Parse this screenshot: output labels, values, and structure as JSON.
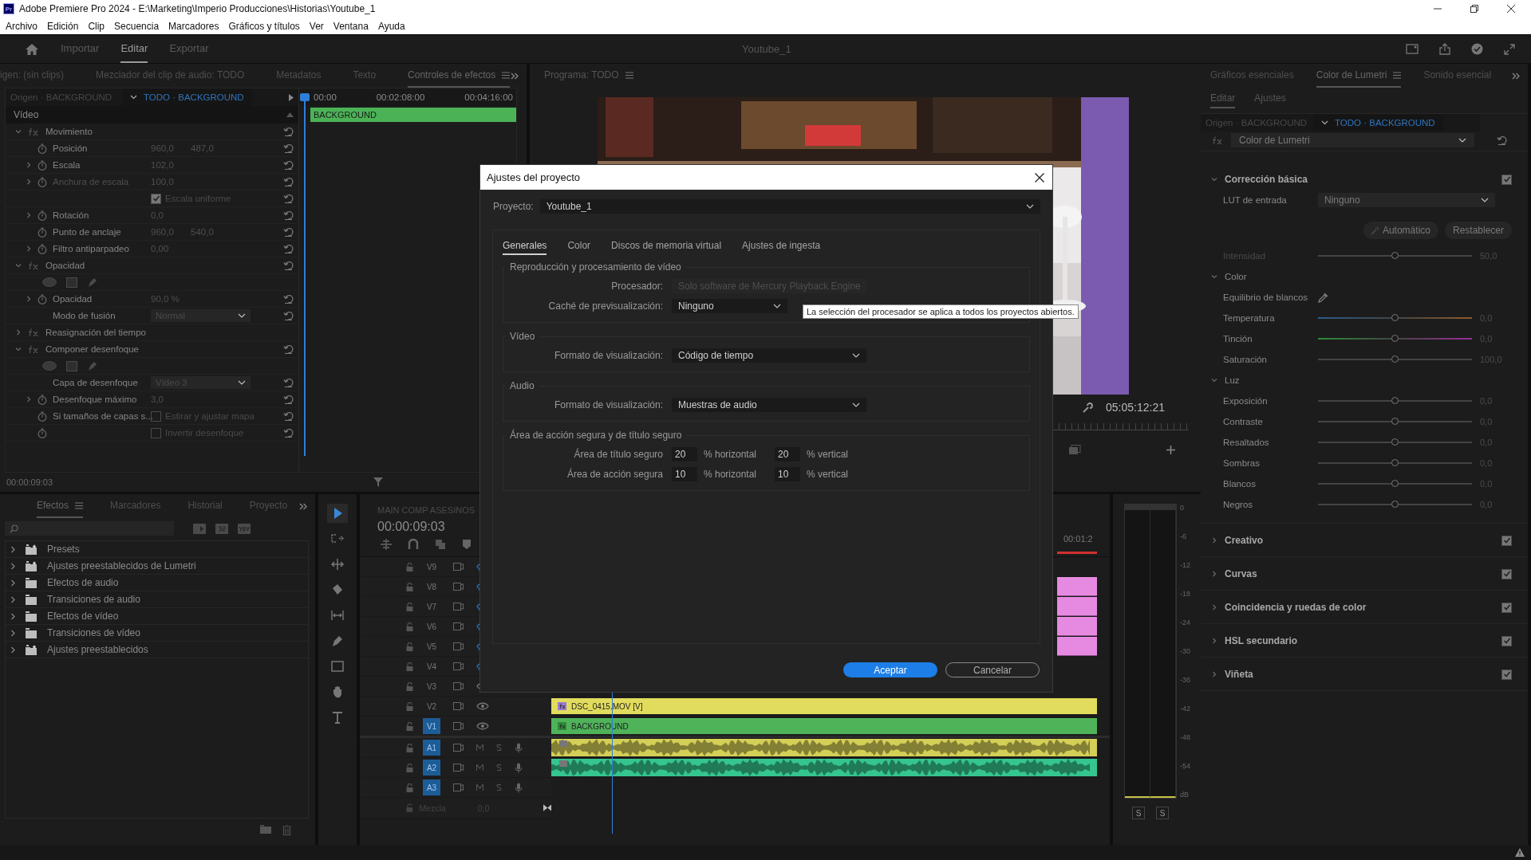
{
  "window": {
    "badge": "Pr",
    "title": "Adobe Premiere Pro 2024 - E:\\Marketing\\Imperio Producciones\\Historias\\Youtube_1"
  },
  "menu": [
    "Archivo",
    "Edición",
    "Clip",
    "Secuencia",
    "Marcadores",
    "Gráficos y títulos",
    "Ver",
    "Ventana",
    "Ayuda"
  ],
  "workspace_tabs": [
    {
      "label": "Importar",
      "selected": false
    },
    {
      "label": "Editar",
      "selected": true
    },
    {
      "label": "Exportar",
      "selected": false
    }
  ],
  "project_name": "Youtube_1",
  "effect_controls": {
    "tabs": [
      {
        "label": "igen: (sin clips)",
        "selected": false
      },
      {
        "label": "Mezclador del clip de audio: TODO",
        "selected": false
      },
      {
        "label": "Metadatos",
        "selected": false
      },
      {
        "label": "Texto",
        "selected": false
      },
      {
        "label": "Controles de efectos",
        "selected": true
      }
    ],
    "source": "Origen · BACKGROUND",
    "sequence": "TODO · BACKGROUND",
    "ruler": [
      "00:00",
      "00:02:08:00",
      "00:04:16:00"
    ],
    "clip": "BACKGROUND",
    "section": "Vídeo",
    "rows": [
      {
        "kind": "effect",
        "label": "Movimiento",
        "expanded": true,
        "resettable": true
      },
      {
        "kind": "param",
        "label": "Posición",
        "values": [
          "960,0",
          "487,0"
        ],
        "expandable": false,
        "disabled": false
      },
      {
        "kind": "param",
        "label": "Escala",
        "values": [
          "102,0"
        ],
        "expandable": true,
        "disabled": false
      },
      {
        "kind": "param",
        "label": "Anchura de escala",
        "values": [
          "100,0"
        ],
        "expandable": true,
        "disabled": true
      },
      {
        "kind": "checkbox",
        "text": "Escala uniforme",
        "checked": true,
        "keyframeable": false
      },
      {
        "kind": "param",
        "label": "Rotación",
        "values": [
          "0,0"
        ],
        "expandable": true,
        "disabled": false
      },
      {
        "kind": "param",
        "label": "Punto de anclaje",
        "values": [
          "960,0",
          "540,0"
        ],
        "expandable": false,
        "disabled": false
      },
      {
        "kind": "param",
        "label": "Filtro antiparpadeo",
        "values": [
          "0,00"
        ],
        "expandable": true,
        "disabled": false
      },
      {
        "kind": "effect",
        "label": "Opacidad",
        "expanded": true,
        "resettable": true
      },
      {
        "kind": "masks"
      },
      {
        "kind": "param",
        "label": "Opacidad",
        "values": [
          "90,0 %"
        ],
        "expandable": true,
        "disabled": false
      },
      {
        "kind": "dropdown",
        "label": "Modo de fusión",
        "value": "Normal"
      },
      {
        "kind": "effect",
        "label": "Reasignación del tiempo",
        "expanded": false,
        "resettable": false
      },
      {
        "kind": "effect",
        "label": "Componer desenfoque",
        "expanded": true,
        "resettable": true
      },
      {
        "kind": "masks"
      },
      {
        "kind": "dropdown",
        "label": "Capa de desenfoque",
        "value": "Vídeo 3"
      },
      {
        "kind": "param",
        "label": "Desenfoque máximo",
        "values": [
          "3,0"
        ],
        "expandable": true,
        "disabled": false
      },
      {
        "kind": "checkbox",
        "label": "Si tamaños de capas s...",
        "text": "Estirar y ajustar mapa",
        "checked": false,
        "keyframeable": true
      },
      {
        "kind": "checkbox",
        "text": "Invertir desenfoque",
        "checked": false,
        "keyframeable": true
      }
    ],
    "timecode": "00:00:09:03"
  },
  "program": {
    "tab": "Programa: TODO",
    "timecode": "05:05:12:21"
  },
  "lumetri": {
    "tabs": [
      {
        "label": "Gráficos esenciales",
        "selected": false
      },
      {
        "label": "Color de Lumetri",
        "selected": true
      },
      {
        "label": "Sonido esencial",
        "selected": false
      }
    ],
    "subtabs": [
      {
        "label": "Editar",
        "selected": true
      },
      {
        "label": "Ajustes",
        "selected": false
      }
    ],
    "source": "Origen · BACKGROUND",
    "sequence": "TODO · BACKGROUND",
    "effect": "Color de Lumetri",
    "basic": {
      "title": "Corrección básica",
      "enabled": true,
      "expanded": true,
      "lut_label": "LUT de entrada",
      "lut_value": "Ninguno",
      "buttons": [
        "Automático",
        "Restablecer"
      ],
      "intensity": {
        "label": "Intensidad",
        "level": 0.5,
        "reading": "50,0",
        "disabled": true
      },
      "groups": [
        {
          "title": "Color",
          "expanded": true,
          "white_balance": "Equilibrio de blancos",
          "sliders": [
            {
              "label": "Temperatura",
              "kind": "temperature",
              "level": 0.5,
              "reading": "0,0"
            },
            {
              "label": "Tinción",
              "kind": "tint",
              "level": 0.5,
              "reading": "0,0"
            },
            {
              "label": "Saturación",
              "kind": "plain",
              "level": 0.5,
              "reading": "100,0"
            }
          ]
        },
        {
          "title": "Luz",
          "expanded": true,
          "sliders": [
            {
              "label": "Exposición",
              "kind": "plain",
              "level": 0.5,
              "reading": "0,0"
            },
            {
              "label": "Contraste",
              "kind": "plain",
              "level": 0.5,
              "reading": "0,0"
            },
            {
              "label": "Resaltados",
              "kind": "plain",
              "level": 0.5,
              "reading": "0,0"
            },
            {
              "label": "Sombras",
              "kind": "plain",
              "level": 0.5,
              "reading": "0,0"
            },
            {
              "label": "Blancos",
              "kind": "plain",
              "level": 0.5,
              "reading": "0,0"
            },
            {
              "label": "Negros",
              "kind": "plain",
              "level": 0.5,
              "reading": "0,0"
            }
          ]
        }
      ]
    },
    "sections": [
      {
        "title": "Creativo",
        "expanded": false,
        "enabled": true
      },
      {
        "title": "Curvas",
        "expanded": false,
        "enabled": true
      },
      {
        "title": "Coincidencia y ruedas de color",
        "expanded": false,
        "enabled": true
      },
      {
        "title": "HSL secundario",
        "expanded": false,
        "enabled": true
      },
      {
        "title": "Viñeta",
        "expanded": false,
        "enabled": true
      }
    ]
  },
  "effects_panel": {
    "tabs": [
      {
        "label": "Efectos",
        "selected": true
      },
      {
        "label": "Marcadores",
        "selected": false
      },
      {
        "label": "Historial",
        "selected": false
      },
      {
        "label": "Proyecto",
        "selected": false
      }
    ],
    "items": [
      {
        "label": "Presets",
        "kind": "preset"
      },
      {
        "label": "Ajustes preestablecidos de Lumetri",
        "kind": "preset"
      },
      {
        "label": "Efectos de audio",
        "kind": "folder"
      },
      {
        "label": "Transiciones de audio",
        "kind": "folder"
      },
      {
        "label": "Efectos de vídeo",
        "kind": "folder"
      },
      {
        "label": "Transiciones de vídeo",
        "kind": "folder"
      },
      {
        "label": "Ajustes preestablecidos",
        "kind": "preset"
      }
    ]
  },
  "tools": [
    {
      "kind": "select",
      "selected": true
    },
    {
      "kind": "track",
      "selected": false
    },
    {
      "kind": "ripple",
      "selected": false
    },
    {
      "kind": "razor",
      "selected": false
    },
    {
      "kind": "slip",
      "selected": false
    },
    {
      "kind": "pen",
      "selected": false
    },
    {
      "kind": "rectangle",
      "selected": false
    },
    {
      "kind": "hand",
      "selected": false
    },
    {
      "kind": "type",
      "selected": false
    }
  ],
  "timeline": {
    "tab": "MAIN COMP ASESINOS",
    "timecode": "00:00:09:03",
    "ruler": "00:01:2",
    "tracks": [
      {
        "name": "V9",
        "kind": "video",
        "targeted": false,
        "visible": false
      },
      {
        "name": "V8",
        "kind": "video",
        "targeted": false,
        "visible": false,
        "clip": {
          "kind": "edge",
          "color": "#e58ae0"
        }
      },
      {
        "name": "V7",
        "kind": "video",
        "targeted": false,
        "visible": false,
        "clip": {
          "kind": "edge",
          "color": "#e58ae0"
        }
      },
      {
        "name": "V6",
        "kind": "video",
        "targeted": false,
        "visible": false,
        "clip": {
          "kind": "edge",
          "color": "#e58ae0"
        }
      },
      {
        "name": "V5",
        "kind": "video",
        "targeted": false,
        "visible": false,
        "clip": {
          "kind": "edge",
          "color": "#e58ae0"
        }
      },
      {
        "name": "V4",
        "kind": "video",
        "targeted": false,
        "visible": false
      },
      {
        "name": "V3",
        "kind": "video",
        "targeted": false,
        "visible": true
      },
      {
        "name": "V2",
        "kind": "video",
        "targeted": false,
        "visible": true,
        "clip": {
          "kind": "video",
          "label": "DSC_0415.MOV [V]",
          "color": "#e2dc5e"
        }
      },
      {
        "name": "V1",
        "kind": "video",
        "targeted": true,
        "visible": true,
        "clip": {
          "kind": "video",
          "label": "BACKGROUND",
          "color": "#4fb35a"
        }
      },
      {
        "name": "A1",
        "kind": "audio",
        "targeted": true,
        "clip": {
          "kind": "audio",
          "color": "#d4cf56"
        }
      },
      {
        "name": "A2",
        "kind": "audio",
        "targeted": true,
        "clip": {
          "kind": "audio",
          "color": "#35c58e"
        }
      },
      {
        "name": "A3",
        "kind": "audio",
        "targeted": true
      }
    ],
    "mix": {
      "label": "Mezcla",
      "value": "0,0"
    }
  },
  "meters": {
    "scale": [
      "0",
      "-6",
      "-12",
      "-18",
      "-24",
      "-30",
      "-36",
      "-42",
      "-48",
      "-54",
      "dB"
    ],
    "solo": [
      "S",
      "S"
    ]
  },
  "dialog": {
    "title": "Ajustes del proyecto",
    "project_label": "Proyecto:",
    "project": "Youtube_1",
    "tabs": [
      {
        "label": "Generales",
        "selected": true
      },
      {
        "label": "Color",
        "selected": false
      },
      {
        "label": "Discos de memoria virtual",
        "selected": false
      },
      {
        "label": "Ajustes de ingesta",
        "selected": false
      }
    ],
    "groups": [
      {
        "title": "Reproducción y procesamiento de vídeo",
        "rows": [
          {
            "kind": "dropdown",
            "label": "Procesador:",
            "value": "Solo software de Mercury Playback Engine",
            "disabled": true
          },
          {
            "kind": "dropdown",
            "label": "Caché de previsualización:",
            "value": "Ninguno",
            "disabled": false
          }
        ]
      },
      {
        "title": "Vídeo",
        "rows": [
          {
            "kind": "dropdown",
            "label": "Formato de visualización:",
            "value": "Código de tiempo",
            "disabled": false
          }
        ]
      },
      {
        "title": "Audio",
        "rows": [
          {
            "kind": "dropdown",
            "label": "Formato de visualización:",
            "value": "Muestras de audio",
            "disabled": false
          }
        ]
      },
      {
        "title": "Área de acción segura y de título seguro",
        "rows": [
          {
            "kind": "percent",
            "label": "Área de título seguro",
            "horizontal": "20",
            "horizontal_unit": "% horizontal",
            "vertical": "20",
            "vertical_unit": "% vertical"
          },
          {
            "kind": "percent",
            "label": "Área de acción segura",
            "horizontal": "10",
            "horizontal_unit": "% horizontal",
            "vertical": "10",
            "vertical_unit": "% vertical"
          }
        ]
      }
    ],
    "tooltip": "La selección del procesador se aplica a todos los proyectos abiertos.",
    "ok": "Aceptar",
    "cancel": "Cancelar"
  }
}
